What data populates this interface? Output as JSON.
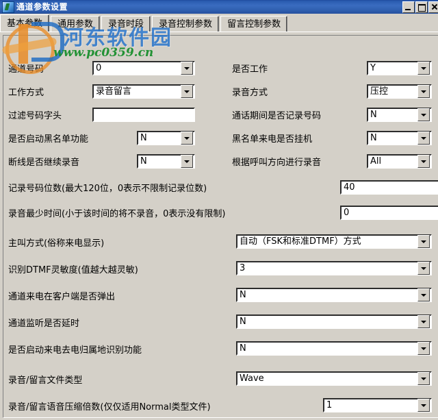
{
  "window": {
    "title": "通道参数设置",
    "icon": "app-icon",
    "buttons": {
      "minimize": "minimize-button",
      "maximize": "maximize-button",
      "close": "close-button"
    }
  },
  "tabs": [
    {
      "label": "基本参数",
      "active": true
    },
    {
      "label": "通用参数",
      "active": false
    },
    {
      "label": "录音时段",
      "active": false
    },
    {
      "label": "录音控制参数",
      "active": false
    },
    {
      "label": "留言控制参数",
      "active": false
    }
  ],
  "watermark": {
    "site_name": "河东软件园",
    "url": "www.pc0359.cn"
  },
  "form": {
    "rows_two_column": [
      {
        "left_label": "通道号码",
        "left_value": "0",
        "left_type": "combo",
        "right_label": "是否工作",
        "right_value": "Y",
        "right_type": "combo"
      },
      {
        "left_label": "工作方式",
        "left_value": "录音留言",
        "left_type": "combo",
        "right_label": "录音方式",
        "right_value": "压控",
        "right_type": "combo"
      },
      {
        "left_label": "过滤号码字头",
        "left_value": "",
        "left_type": "text",
        "right_label": "通话期间是否记录号码",
        "right_value": "N",
        "right_type": "combo"
      },
      {
        "left_label": "是否启动黑名单功能",
        "left_value": "N",
        "left_type": "combo",
        "right_label": "黑名单来电是否挂机",
        "right_value": "N",
        "right_type": "combo"
      },
      {
        "left_label": "断线是否继续录音",
        "left_value": "N",
        "left_type": "combo",
        "right_label": "根据呼叫方向进行录音",
        "right_value": "All",
        "right_type": "combo"
      }
    ],
    "rows_wide": [
      {
        "label": "记录号码位数(最大120位，0表示不限制记录位数)",
        "value": "40",
        "type": "text"
      },
      {
        "label": "录音最少时间(小于该时间的将不录音，0表示没有限制)",
        "value": "0",
        "type": "text"
      },
      {
        "label": "主叫方式(俗称来电显示)",
        "value": "自动（FSK和标准DTMF）方式",
        "type": "combo"
      },
      {
        "label": "识别DTMF灵敏度(值越大越灵敏)",
        "value": "3",
        "type": "combo"
      },
      {
        "label": "通道来电在客户端是否弹出",
        "value": "N",
        "type": "combo"
      },
      {
        "label": "通道监听是否延时",
        "value": "N",
        "type": "combo"
      },
      {
        "label": "是否启动来电去电归属地识别功能",
        "value": "N",
        "type": "combo"
      },
      {
        "label": "录音/留言文件类型",
        "value": "Wave",
        "type": "combo"
      },
      {
        "label": "录音/留言语音压缩倍数(仅仅适用Normal类型文件)",
        "value": "1",
        "type": "combo"
      }
    ]
  }
}
